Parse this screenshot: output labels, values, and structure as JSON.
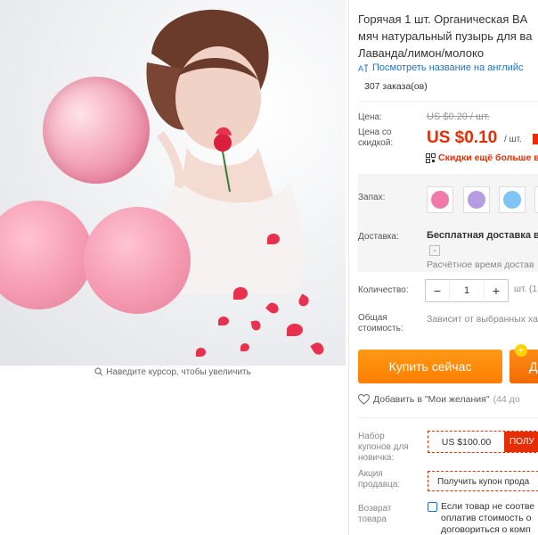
{
  "gallery": {
    "zoom_hint": "Наведите курсор, чтобы увеличить",
    "zoom_icon": "magnifier-icon"
  },
  "product": {
    "title_lines": [
      "Горячая 1 шт. Органическая BA",
      "мяч натуральный пузырь для ва",
      "Лаванда/лимон/молоко"
    ],
    "translate_link": "Посмотреть название на английс",
    "orders": "307 заказа(ов)"
  },
  "price": {
    "label": "Цена:",
    "old": "US $0.20 / шт.",
    "discount_label_1": "Цена со",
    "discount_label_2": "скидкой:",
    "current": "US $0.10",
    "unit": "/ шт.",
    "promo": "Скидки ещё больше в"
  },
  "options": {
    "scent_label": "Запах:",
    "swatches": [
      {
        "name": "pink",
        "color": "#f07ba8"
      },
      {
        "name": "purple",
        "color": "#b69ce0"
      },
      {
        "name": "blue",
        "color": "#7ec4f4"
      },
      {
        "name": "yellow",
        "color": "#f3d21f"
      }
    ]
  },
  "shipping": {
    "label": "Доставка:",
    "main": "Бесплатная доставка в",
    "time": "Расчётное время достав"
  },
  "quantity": {
    "label": "Количество:",
    "minus": "−",
    "value": "1",
    "plus": "+",
    "unit": "шт. (1"
  },
  "total": {
    "label_1": "Общая",
    "label_2": "стоимость:",
    "value": "Зависит от выбранных хар"
  },
  "actions": {
    "buy": "Купить сейчас",
    "cart": "Д",
    "wishlist": "Добавить в \"Мои желания\"",
    "wishlist_count": "(44 до"
  },
  "coupons": {
    "new_label": [
      "Набор",
      "купонов для",
      "новичка:"
    ],
    "new_amount": "US $100.00",
    "new_action": "ПОЛУ",
    "seller_label": [
      "Акция",
      "продавца:"
    ],
    "seller_action": "Получить купон прода",
    "return_label": [
      "Возврат",
      "товара"
    ],
    "return_text": [
      "Если товар не соотве",
      "оплатив стоимость о",
      "договориться о комп"
    ]
  },
  "colors": {
    "accent": "#e62e04",
    "buy": "#ff8c00",
    "link": "#1e74c8"
  }
}
